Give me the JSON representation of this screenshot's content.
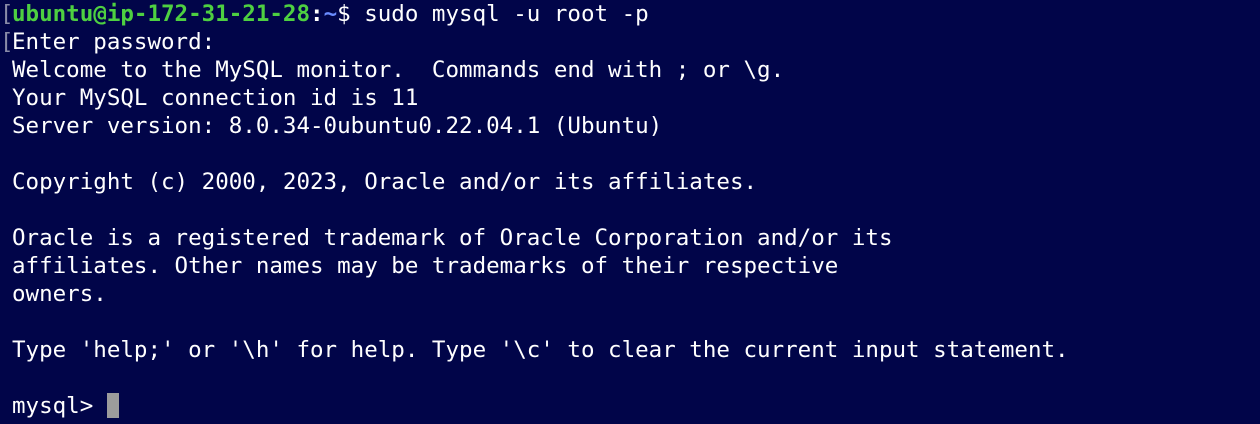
{
  "terminal": {
    "prompt_user_host": "ubuntu@ip-172-31-21-28",
    "prompt_separator": ":",
    "prompt_path": "~",
    "prompt_symbol": "$ ",
    "command": "sudo mysql -u root -p",
    "lines": {
      "password": "Enter password:",
      "welcome": "Welcome to the MySQL monitor.  Commands end with ; or \\g.",
      "connection": "Your MySQL connection id is 11",
      "server": "Server version: 8.0.34-0ubuntu0.22.04.1 (Ubuntu)",
      "copyright": "Copyright (c) 2000, 2023, Oracle and/or its affiliates.",
      "trademark_1": "Oracle is a registered trademark of Oracle Corporation and/or its",
      "trademark_2": "affiliates. Other names may be trademarks of their respective",
      "trademark_3": "owners.",
      "help": "Type 'help;' or '\\h' for help. Type '\\c' to clear the current input statement."
    },
    "mysql_prompt": "mysql> "
  },
  "colors": {
    "background": "#010549",
    "text": "#ffffff",
    "user_host": "#4ed041",
    "path": "#6a8cff",
    "cursor": "#9c9c9c"
  }
}
